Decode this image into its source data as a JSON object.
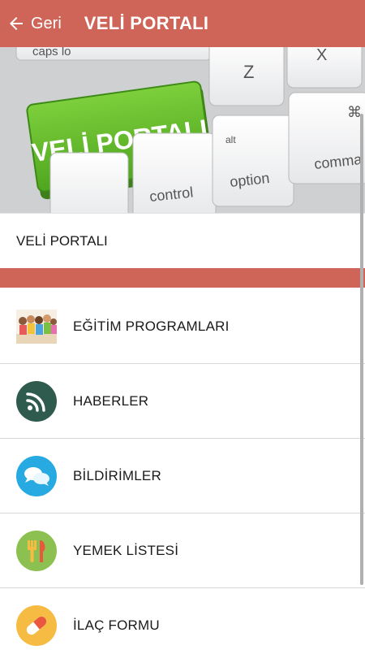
{
  "header": {
    "back_label": "Geri",
    "title": "VELİ PORTALI"
  },
  "hero": {
    "key_main": "VELİ PORTALI",
    "key_caps": "caps lo",
    "key_z": "Z",
    "key_x": "X",
    "key_control": "control",
    "key_alt": "alt",
    "key_option": "option",
    "key_cmd_symbol": "⌘",
    "key_command": "comma"
  },
  "subtitle": "VELİ PORTALI",
  "colors": {
    "accent": "#cf6558"
  },
  "menu": {
    "items": [
      {
        "label": "EĞİTİM PROGRAMLARI",
        "icon": "kids-photo-icon"
      },
      {
        "label": "HABERLER",
        "icon": "rss-icon"
      },
      {
        "label": "BİLDİRİMLER",
        "icon": "chat-bubbles-icon"
      },
      {
        "label": "YEMEK LİSTESİ",
        "icon": "fork-knife-icon"
      },
      {
        "label": "İLAÇ FORMU",
        "icon": "pill-icon"
      }
    ]
  }
}
